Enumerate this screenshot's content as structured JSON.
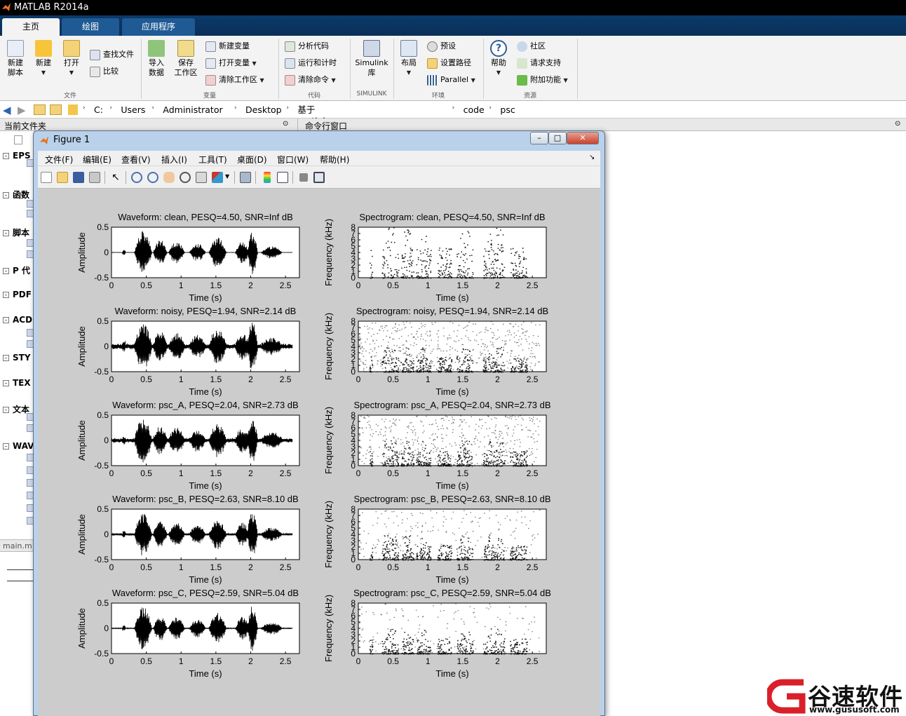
{
  "window": {
    "title": "MATLAB R2014a"
  },
  "tabs": [
    {
      "label": "主页"
    },
    {
      "label": "绘图"
    },
    {
      "label": "应用程序"
    }
  ],
  "ribbon": {
    "new_script": "新建\n脚本",
    "new": "新建",
    "open": "打开",
    "find_files": "查找文件",
    "compare": "比较",
    "import_data": "导入\n数据",
    "save_workspace": "保存\n工作区",
    "new_variable": "新建变量",
    "open_variable": "打开变量",
    "clear_workspace": "清除工作区",
    "analyze_code": "分析代码",
    "run_and_time": "运行和计时",
    "clear_commands": "清除命令",
    "simulink": "Simulink\n库",
    "layout": "布局",
    "preferences": "预设",
    "set_path": "设置路径",
    "parallel": "Parallel",
    "help": "帮助",
    "community": "社区",
    "request_support": "请求支持",
    "add_ons": "附加功能",
    "sections": {
      "file": "文件",
      "variable": "变量",
      "code": "代码",
      "simulink": "SIMULINK",
      "environment": "环境",
      "resources": "资源"
    }
  },
  "address": {
    "crumbs": [
      "C:",
      "Users",
      "Administrator",
      "Desktop",
      "基于matlab编程相位谱补偿源码程序",
      "code",
      "psc"
    ]
  },
  "panels": {
    "current_folder": "当前文件夹",
    "command_window": "命令行窗口"
  },
  "folder_groups": [
    "EPS",
    "函数",
    "脚本",
    "P 代",
    "PDF",
    "ACD",
    "STY",
    "TEX",
    "文本",
    "WAV"
  ],
  "details_label": "main.m",
  "figure": {
    "title": "Figure 1",
    "menu": [
      "文件(F)",
      "编辑(E)",
      "查看(V)",
      "插入(I)",
      "工具(T)",
      "桌面(D)",
      "窗口(W)",
      "帮助(H)"
    ]
  },
  "chart_data": [
    {
      "type": "line",
      "title": "Waveform: clean,  PESQ=4.50,  SNR=Inf dB",
      "xlabel": "Time (s)",
      "ylabel": "Amplitude",
      "xlim": [
        0,
        2.7
      ],
      "ylim": [
        -0.5,
        0.5
      ],
      "xticks": [
        "0",
        "0.5",
        "1",
        "1.5",
        "2",
        "2.5"
      ],
      "yticks": [
        "0.5",
        "0",
        "-0.5"
      ],
      "noise": 0.003
    },
    {
      "type": "heatmap",
      "title": "Spectrogram: clean,  PESQ=4.50,  SNR=Inf dB",
      "xlabel": "Time (s)",
      "ylabel": "Frequency (kHz)",
      "xlim": [
        0,
        2.7
      ],
      "ylim": [
        0,
        8
      ],
      "xticks": [
        "0",
        "0.5",
        "1",
        "1.5",
        "2",
        "2.5"
      ],
      "yticks": [
        "0",
        "1",
        "2",
        "3",
        "4",
        "5",
        "6",
        "7",
        "8"
      ],
      "noise": 0.0
    },
    {
      "type": "line",
      "title": "Waveform: noisy,  PESQ=1.94,  SNR=2.14 dB",
      "xlabel": "Time (s)",
      "ylabel": "Amplitude",
      "xlim": [
        0,
        2.7
      ],
      "ylim": [
        -0.5,
        0.5
      ],
      "xticks": [
        "0",
        "0.5",
        "1",
        "1.5",
        "2",
        "2.5"
      ],
      "yticks": [
        "0.5",
        "0",
        "-0.5"
      ],
      "noise": 0.06
    },
    {
      "type": "heatmap",
      "title": "Spectrogram: noisy,  PESQ=1.94,  SNR=2.14 dB",
      "xlabel": "Time (s)",
      "ylabel": "Frequency (kHz)",
      "xlim": [
        0,
        2.7
      ],
      "ylim": [
        0,
        8
      ],
      "xticks": [
        "0",
        "0.5",
        "1",
        "1.5",
        "2",
        "2.5"
      ],
      "yticks": [
        "0",
        "1",
        "2",
        "3",
        "4",
        "5",
        "6",
        "7",
        "8"
      ],
      "noise": 0.55
    },
    {
      "type": "line",
      "title": "Waveform: psc_A,  PESQ=2.04,  SNR=2.73 dB",
      "xlabel": "Time (s)",
      "ylabel": "Amplitude",
      "xlim": [
        0,
        2.7
      ],
      "ylim": [
        -0.5,
        0.5
      ],
      "xticks": [
        "0",
        "0.5",
        "1",
        "1.5",
        "2",
        "2.5"
      ],
      "yticks": [
        "0.5",
        "0",
        "-0.5"
      ],
      "noise": 0.05
    },
    {
      "type": "heatmap",
      "title": "Spectrogram: psc_A,  PESQ=2.04,  SNR=2.73 dB",
      "xlabel": "Time (s)",
      "ylabel": "Frequency (kHz)",
      "xlim": [
        0,
        2.7
      ],
      "ylim": [
        0,
        8
      ],
      "xticks": [
        "0",
        "0.5",
        "1",
        "1.5",
        "2",
        "2.5"
      ],
      "yticks": [
        "0",
        "1",
        "2",
        "3",
        "4",
        "5",
        "6",
        "7",
        "8"
      ],
      "noise": 0.5
    },
    {
      "type": "line",
      "title": "Waveform: psc_B,  PESQ=2.63,  SNR=8.10 dB",
      "xlabel": "Time (s)",
      "ylabel": "Amplitude",
      "xlim": [
        0,
        2.7
      ],
      "ylim": [
        -0.5,
        0.5
      ],
      "xticks": [
        "0",
        "0.5",
        "1",
        "1.5",
        "2",
        "2.5"
      ],
      "yticks": [
        "0.5",
        "0",
        "-0.5"
      ],
      "noise": 0.02
    },
    {
      "type": "heatmap",
      "title": "Spectrogram: psc_B,  PESQ=2.63,  SNR=8.10 dB",
      "xlabel": "Time (s)",
      "ylabel": "Frequency (kHz)",
      "xlim": [
        0,
        2.7
      ],
      "ylim": [
        0,
        8
      ],
      "xticks": [
        "0",
        "0.5",
        "1",
        "1.5",
        "2",
        "2.5"
      ],
      "yticks": [
        "0",
        "1",
        "2",
        "3",
        "4",
        "5",
        "6",
        "7",
        "8"
      ],
      "noise": 0.22
    },
    {
      "type": "line",
      "title": "Waveform: psc_C,  PESQ=2.59,  SNR=5.04 dB",
      "xlabel": "Time (s)",
      "ylabel": "Amplitude",
      "xlim": [
        0,
        2.7
      ],
      "ylim": [
        -0.5,
        0.5
      ],
      "xticks": [
        "0",
        "0.5",
        "1",
        "1.5",
        "2",
        "2.5"
      ],
      "yticks": [
        "0.5",
        "0",
        "-0.5"
      ],
      "noise": 0.01
    },
    {
      "type": "heatmap",
      "title": "Spectrogram: psc_C,  PESQ=2.59,  SNR=5.04 dB",
      "xlabel": "Time (s)",
      "ylabel": "Frequency (kHz)",
      "xlim": [
        0,
        2.7
      ],
      "ylim": [
        0,
        8
      ],
      "xticks": [
        "0",
        "0.5",
        "1",
        "1.5",
        "2",
        "2.5"
      ],
      "yticks": [
        "0",
        "1",
        "2",
        "3",
        "4",
        "5",
        "6",
        "7",
        "8"
      ],
      "noise": 0.14
    }
  ],
  "watermark": {
    "name": "谷速软件",
    "url": "www.gususoft.com"
  },
  "colors": {
    "accent": "#0b3a6a",
    "figure_bg": "#cccccc",
    "logo_red": "#d9202a"
  }
}
